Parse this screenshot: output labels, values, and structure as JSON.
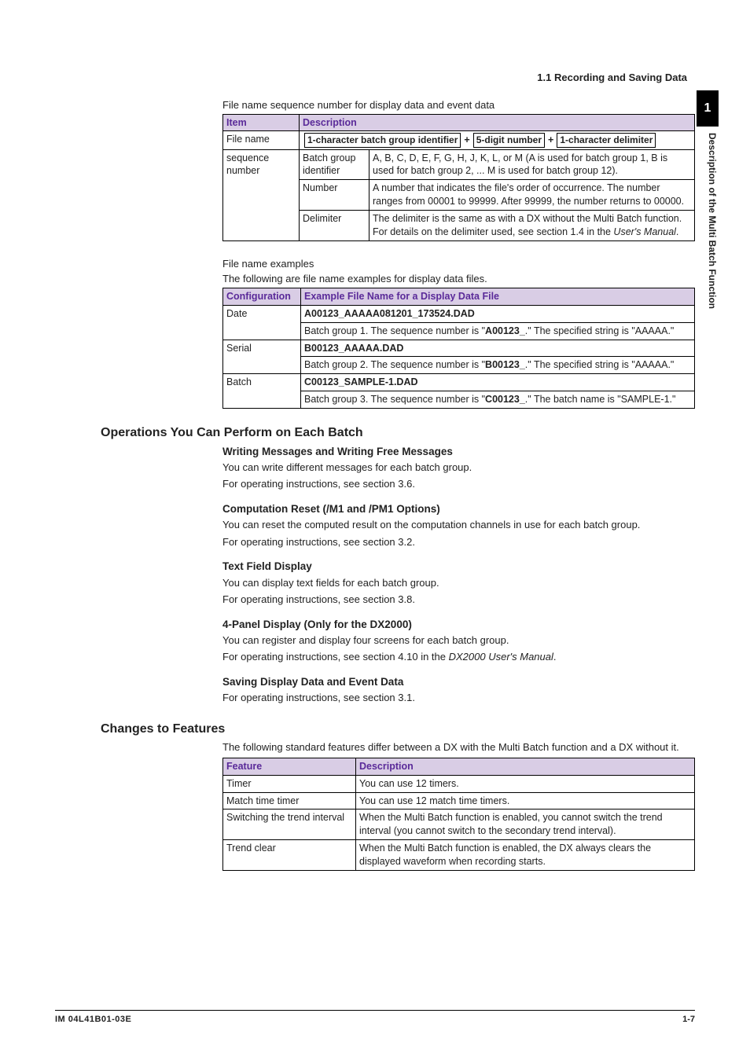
{
  "header": {
    "section_title": "1.1  Recording and Saving Data"
  },
  "side": {
    "chapter_num": "1",
    "chapter_title": "Description of the Multi Batch Function"
  },
  "table1": {
    "caption": "File name sequence number for display data and event data",
    "h_item": "Item",
    "h_desc": "Description",
    "r_filename_item": "File name",
    "r_filename_box1": "1-character batch group identifier",
    "r_filename_box2": "5-digit number",
    "r_filename_box3": "1-character delimiter",
    "r_seq_item": "sequence number",
    "r_bgi_label": "Batch group identifier",
    "r_bgi_desc": "A, B, C, D, E, F, G, H, J, K, L, or M (A is used for batch group 1, B is used for batch group 2, ... M is used for batch group 12).",
    "r_num_label": "Number",
    "r_num_desc": "A number that indicates the file's order of occurrence. The number ranges from 00001 to 99999. After 99999, the number returns to 00000.",
    "r_del_label": "Delimiter",
    "r_del_desc_a": "The delimiter is the same as with a DX without the Multi Batch function. For details on the delimiter used, see section 1.4 in the ",
    "r_del_desc_b": "User's Manual",
    "r_del_desc_c": "."
  },
  "examples": {
    "title": "File name examples",
    "intro": "The following are file name examples for display data files.",
    "h_conf": "Configuration",
    "h_example": "Example File Name for a Display Data File",
    "date_label": "Date",
    "date_fn": "A00123_AAAAA081201_173524.DAD",
    "date_desc_a": "Batch group 1. The sequence number is \"",
    "date_desc_b": "A00123_",
    "date_desc_c": ".\" The specified string is \"AAAAA.\"",
    "serial_label": "Serial",
    "serial_fn": "B00123_AAAAA.DAD",
    "serial_desc_a": "Batch group 2. The sequence number is \"",
    "serial_desc_b": "B00123_",
    "serial_desc_c": ".\" The specified string is \"AAAAA.\"",
    "batch_label": "Batch",
    "batch_fn": "C00123_SAMPLE-1.DAD",
    "batch_desc_a": "Batch group 3. The sequence number is \"",
    "batch_desc_b": "C00123_",
    "batch_desc_c": ".\" The batch name is \"SAMPLE-1.\""
  },
  "ops": {
    "heading": "Operations You Can Perform on Each Batch",
    "wm_h": "Writing Messages and Writing Free Messages",
    "wm_p1": "You can write different messages for each batch group.",
    "wm_p2": "For operating instructions, see section 3.6.",
    "cr_h": "Computation Reset (/M1 and /PM1 Options)",
    "cr_p1": "You can reset the computed result on the computation channels in use for each batch group.",
    "cr_p2": "For operating instructions, see section 3.2.",
    "tf_h": "Text Field Display",
    "tf_p1": "You can display text fields for each batch group.",
    "tf_p2": "For operating instructions, see section 3.8.",
    "fp_h": "4-Panel Display (Only for the DX2000)",
    "fp_p1": "You can register and display four screens for each batch group.",
    "fp_p2a": "For operating instructions, see section 4.10 in the ",
    "fp_p2b": "DX2000 User's Manual",
    "fp_p2c": ".",
    "sd_h": "Saving Display Data and Event Data",
    "sd_p1": "For operating instructions, see section 3.1."
  },
  "changes": {
    "heading": "Changes to Features",
    "intro": "The following standard features differ between a DX with the Multi Batch function and a DX without it.",
    "h_feature": "Feature",
    "h_desc": "Description",
    "timer_f": "Timer",
    "timer_d": "You can use 12 timers.",
    "mtt_f": "Match time timer",
    "mtt_d": "You can use 12 match time timers.",
    "sti_f": "Switching the trend interval",
    "sti_d": "When the Multi Batch function is enabled, you cannot switch the trend interval (you cannot switch to the secondary trend interval).",
    "tc_f": "Trend clear",
    "tc_d": "When the Multi Batch function is enabled, the DX always clears the displayed waveform when recording starts."
  },
  "footer": {
    "left": "IM 04L41B01-03E",
    "right": "1-7"
  }
}
